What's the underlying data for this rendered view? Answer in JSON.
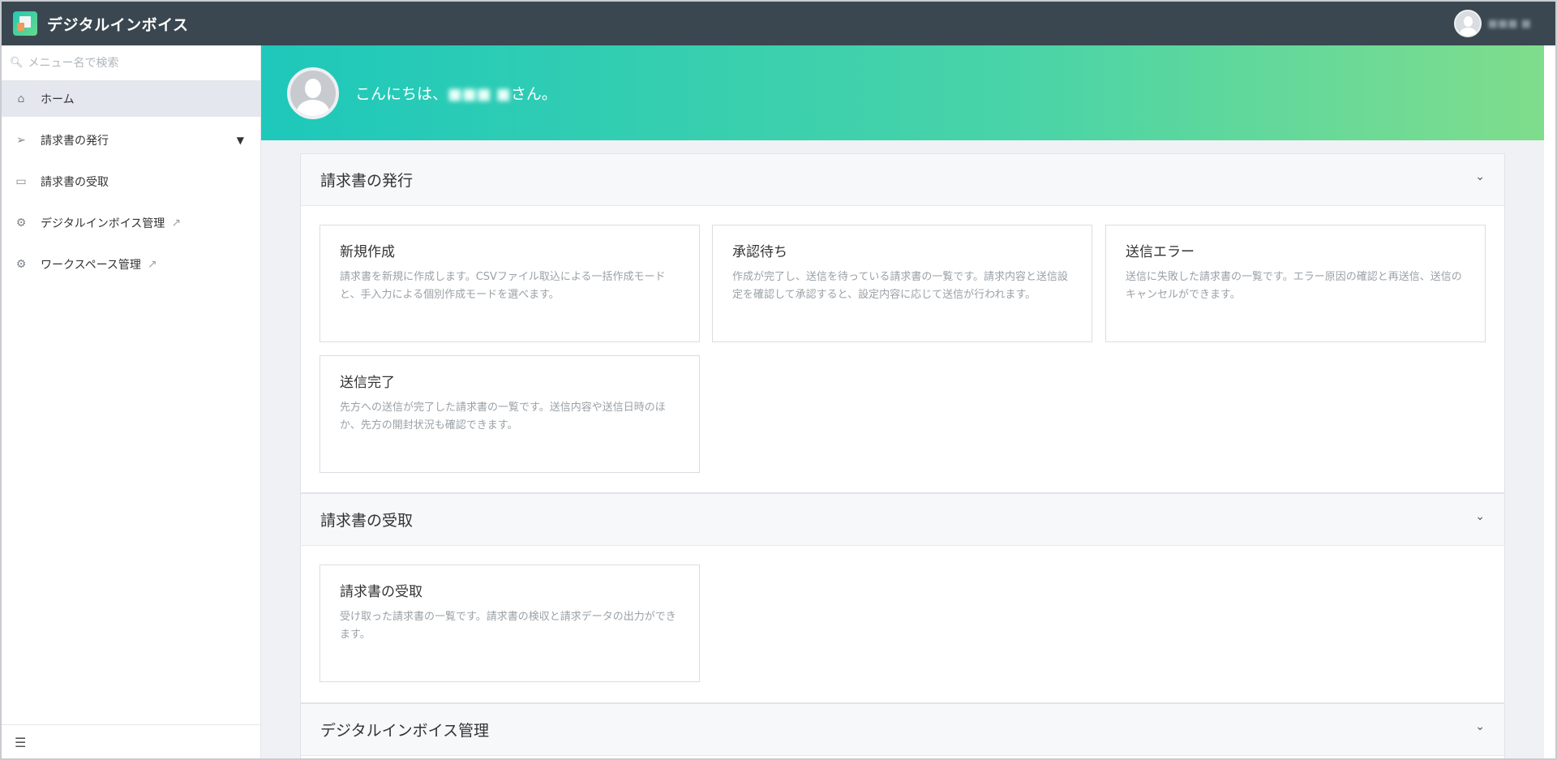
{
  "header": {
    "app_title": "デジタルインボイス",
    "user_name": "■■■ ■"
  },
  "sidebar": {
    "search_placeholder": "メニュー名で検索",
    "items": [
      {
        "label": "ホーム",
        "icon": "home-icon"
      },
      {
        "label": "請求書の発行",
        "icon": "send-icon"
      },
      {
        "label": "請求書の受取",
        "icon": "folder-icon"
      },
      {
        "label": "デジタルインボイス管理",
        "icon": "gear-icon"
      },
      {
        "label": "ワークスペース管理",
        "icon": "gear-icon"
      }
    ]
  },
  "hero": {
    "greeting_prefix": "こんにちは、",
    "user_name": "■■■ ■",
    "greeting_suffix": "さん。"
  },
  "sections": [
    {
      "title": "請求書の発行",
      "cards": [
        {
          "title": "新規作成",
          "desc": "請求書を新規に作成します。CSVファイル取込による一括作成モードと、手入力による個別作成モードを選べます。"
        },
        {
          "title": "承認待ち",
          "desc": "作成が完了し、送信を待っている請求書の一覧です。請求内容と送信設定を確認して承認すると、設定内容に応じて送信が行われます。"
        },
        {
          "title": "送信エラー",
          "desc": "送信に失敗した請求書の一覧です。エラー原因の確認と再送信、送信のキャンセルができます。"
        },
        {
          "title": "送信完了",
          "desc": "先方への送信が完了した請求書の一覧です。送信内容や送信日時のほか、先方の開封状況も確認できます。"
        }
      ]
    },
    {
      "title": "請求書の受取",
      "cards": [
        {
          "title": "請求書の受取",
          "desc": "受け取った請求書の一覧です。請求書の検収と請求データの出力ができます。"
        }
      ]
    },
    {
      "title": "デジタルインボイス管理",
      "cards": []
    }
  ]
}
